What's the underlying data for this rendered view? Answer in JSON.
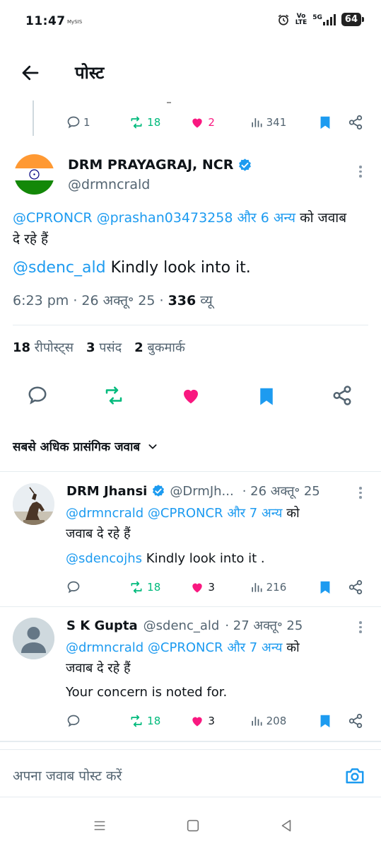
{
  "status_bar": {
    "time": "11:47",
    "carrier": "MySIS",
    "network_top": "Vo",
    "network_bottom": "LTE",
    "network_gen": "5G",
    "battery": "64"
  },
  "header": {
    "title": "पोस्ट"
  },
  "parent_post_actions": {
    "replies": "1",
    "reposts": "18",
    "likes": "2",
    "views": "341"
  },
  "main_post": {
    "display_name": "DRM PRAYAGRAJ, NCR",
    "handle": "@drmncrald",
    "replying_mentions": "@CPRONCR @prashan03473258",
    "replying_others": "और 6 अन्य",
    "replying_suffix": "को जवाब",
    "replying_suffix2": "दे रहे हैं",
    "text_mention": "@sdenc_ald",
    "text": "Kindly look into it.",
    "timestamp": "6:23 pm · 26 अक्तू॰ 25 · ",
    "views_count": "336",
    "views_label": "व्यू",
    "stats": {
      "reposts_count": "18",
      "reposts_label": "रीपोस्ट्स",
      "likes_count": "3",
      "likes_label": "पसंद",
      "bookmarks_count": "2",
      "bookmarks_label": "बुकमार्क"
    }
  },
  "sort": {
    "label": "सबसे अधिक प्रासंगिक जवाब"
  },
  "replies": [
    {
      "display_name": "DRM Jhansi",
      "handle": "@DrmJh...",
      "date": "· 26 अक्तू॰ 25",
      "replying_mentions": "@drmncrald @CPRONCR",
      "replying_others": "और 7 अन्य",
      "replying_suffix": "को",
      "replying_suffix2": "जवाब दे रहे हैं",
      "text_mention": "@sdencojhs",
      "text": "Kindly look into it .",
      "reposts": "18",
      "likes": "3",
      "views": "216"
    },
    {
      "display_name": "S K Gupta",
      "handle": "@sdenc_ald",
      "date": "· 27 अक्तू॰ 25",
      "replying_mentions": "@drmncrald @CPRONCR",
      "replying_others": "और 7 अन्य",
      "replying_suffix": "को",
      "replying_suffix2": "जवाब दे रहे हैं",
      "text": "Your concern is noted for.",
      "reposts": "18",
      "likes": "3",
      "views": "208"
    }
  ],
  "composer": {
    "placeholder": "अपना जवाब पोस्ट करें"
  },
  "colors": {
    "accent_blue": "#1d9bf0",
    "repost_green": "#00ba7c",
    "like_pink": "#f91880",
    "secondary_text": "#536471"
  }
}
